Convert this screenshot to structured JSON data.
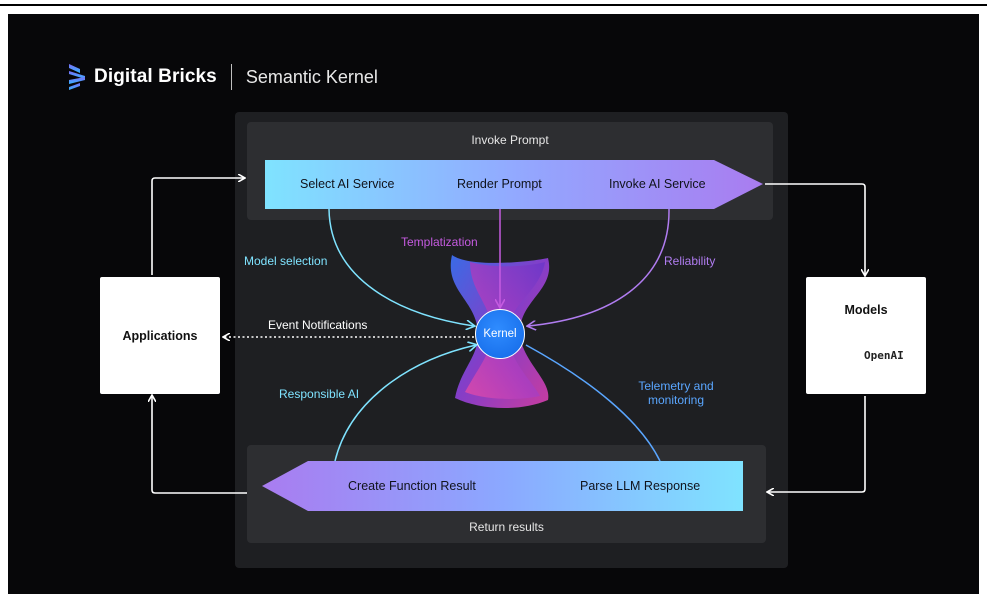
{
  "header": {
    "brand_name": "Digital Bricks",
    "product_name": "Semantic Kernel"
  },
  "top_panel": {
    "title": "Invoke Prompt",
    "steps": [
      "Select AI Service",
      "Render Prompt",
      "Invoke AI Service"
    ]
  },
  "bottom_panel": {
    "title": "Return results",
    "steps": [
      "Create Function Result",
      "Parse LLM Response"
    ]
  },
  "kernel": {
    "label": "Kernel"
  },
  "applications": {
    "label": "Applications"
  },
  "models": {
    "title": "Models",
    "provider_label": "OpenAI"
  },
  "edges": {
    "model_selection": "Model selection",
    "templatization": "Templatization",
    "reliability": "Reliability",
    "event_notifications": "Event Notifications",
    "responsible_ai": "Responsible AI",
    "telemetry": "Telemetry and",
    "telemetry_line2": "monitoring"
  },
  "colors": {
    "background": "#070709",
    "panel": "#1e1f22",
    "sub_panel": "#2d2e31",
    "cyan": "#7fe3ff",
    "blue": "#5aa6ff",
    "purple": "#a97cf0",
    "kernel": "#1a73ee"
  },
  "icons": [
    "digital-bricks-logo",
    "azure-logo",
    "openai-logo"
  ]
}
